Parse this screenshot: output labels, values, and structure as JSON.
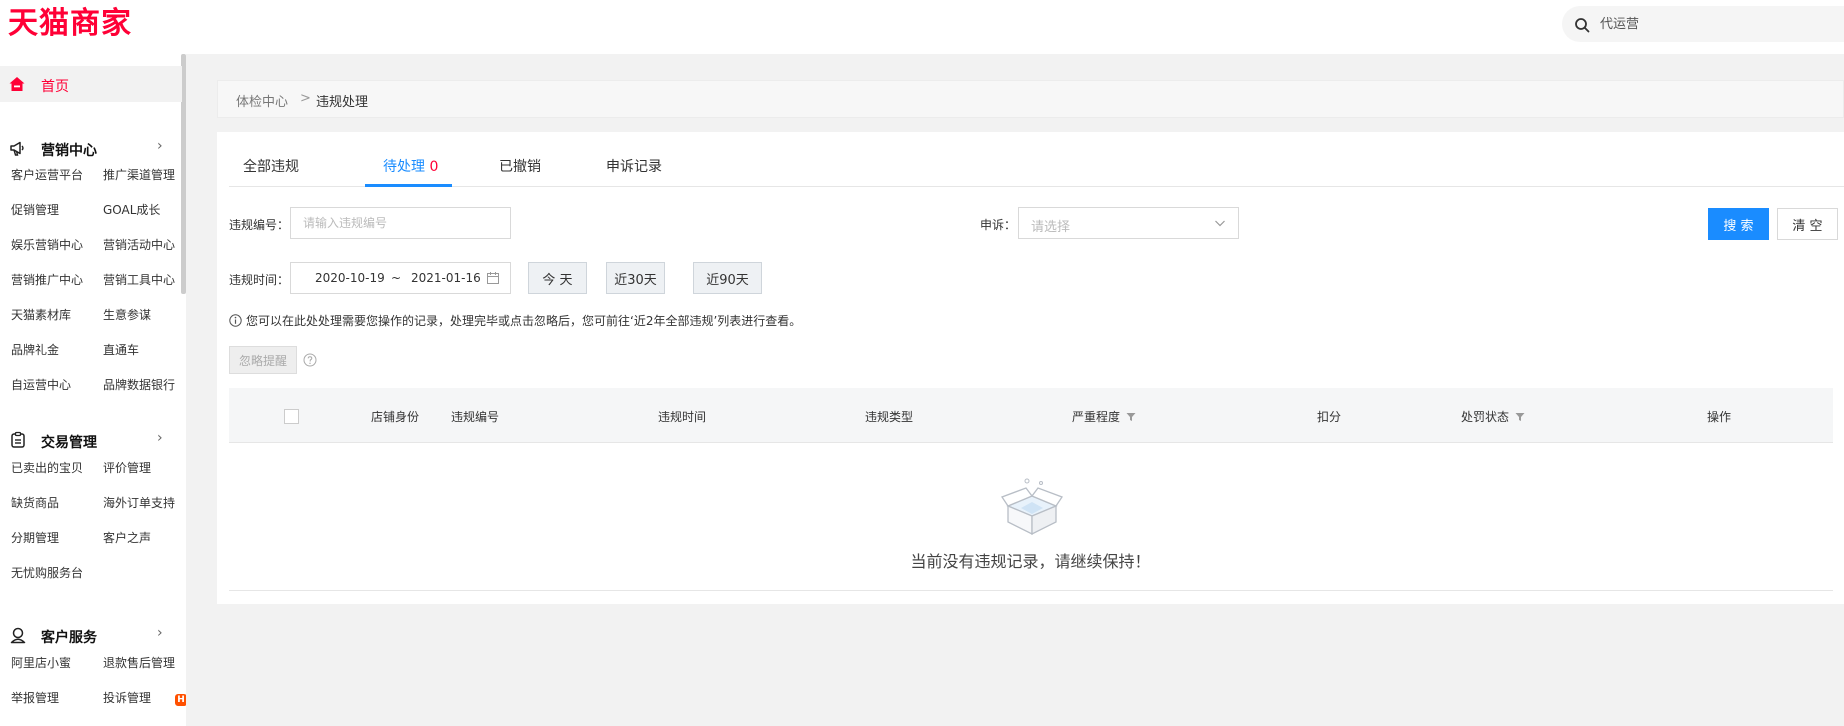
{
  "header": {
    "logo_text": "天猫商家",
    "search_placeholder": "代运营"
  },
  "sidebar": {
    "home": "首页",
    "groups": [
      {
        "title": "营销中心",
        "items": [
          "客户运营平台",
          "推广渠道管理",
          "促销管理",
          "GOAL成长",
          "娱乐营销中心",
          "营销活动中心",
          "营销推广中心",
          "营销工具中心",
          "天猫素材库",
          "生意参谋",
          "品牌礼金",
          "直通车",
          "自运营中心",
          "品牌数据银行"
        ]
      },
      {
        "title": "交易管理",
        "items": [
          "已卖出的宝贝",
          "评价管理",
          "缺货商品",
          "海外订单支持",
          "分期管理",
          "客户之声",
          "无忧购服务台"
        ]
      },
      {
        "title": "客户服务",
        "items": [
          "阿里店小蜜",
          "退款售后管理",
          "举报管理",
          "投诉管理"
        ]
      }
    ],
    "new_badge": "H"
  },
  "breadcrumb": {
    "parent": "体检中心",
    "separator": ">",
    "current": "违规处理"
  },
  "tabs": [
    {
      "label": "全部违规"
    },
    {
      "label": "待处理",
      "count": "0"
    },
    {
      "label": "已撤销"
    },
    {
      "label": "申诉记录"
    }
  ],
  "filters": {
    "violation_no_label": "违规编号：",
    "violation_no_placeholder": "请输入违规编号",
    "appeal_label": "申诉：",
    "appeal_placeholder": "请选择",
    "search_button": "搜 索",
    "clear_button": "清 空",
    "time_label": "违规时间：",
    "date_start": "2020-10-19",
    "date_sep": "~",
    "date_end": "2021-01-16",
    "quick_today": "今 天",
    "quick_30": "近30天",
    "quick_90": "近90天"
  },
  "notice": "您可以在此处处理需要您操作的记录，处理完毕或点击忽略后，您可前往‘近2年全部违规’列表进行查看。",
  "ignore_button": "忽略提醒",
  "table": {
    "columns": [
      "店铺身份",
      "违规编号",
      "违规时间",
      "违规类型",
      "严重程度",
      "扣分",
      "处罚状态",
      "操作"
    ]
  },
  "empty_message": "当前没有违规记录，请继续保持！",
  "colors": {
    "brand": "#ff0036",
    "primary": "#1a8cff"
  }
}
